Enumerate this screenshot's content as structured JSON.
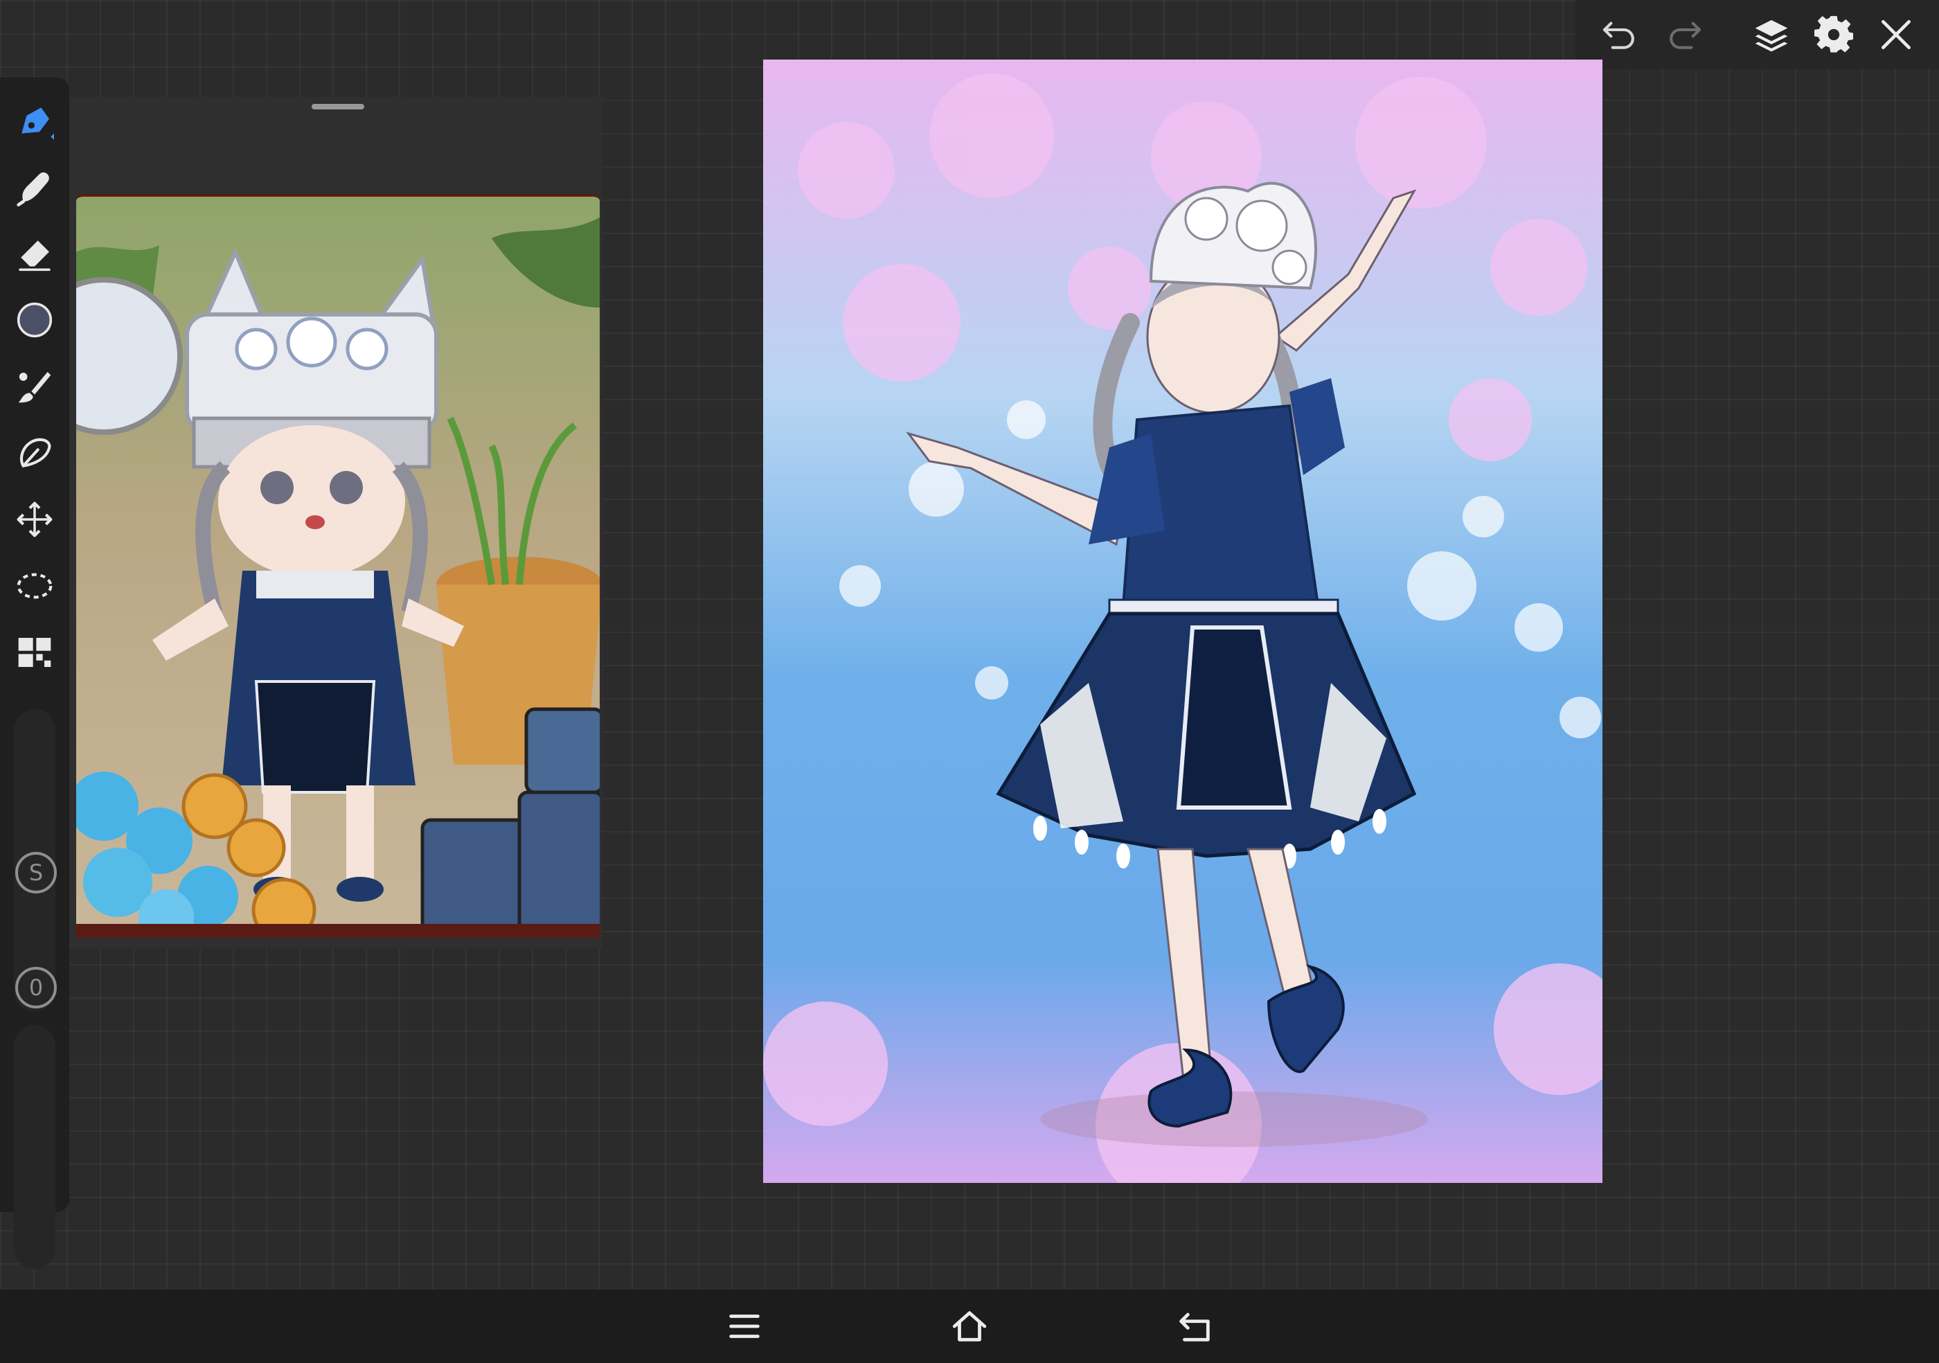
{
  "colors": {
    "accent": "#3d8ff5",
    "icon": "#e8e8e8",
    "icon_dim": "#8a8a8a",
    "rail": "#1f1f1f",
    "panel": "#2f2f2f"
  },
  "toolbar": {
    "icons": [
      "undo-icon",
      "redo-icon",
      "layers-icon",
      "settings-icon",
      "close-icon"
    ]
  },
  "tools": [
    "pen-icon",
    "smudge-icon",
    "eraser-icon",
    "color-icon",
    "brush-icon",
    "lasso-fill-icon",
    "transform-icon",
    "selection-icon",
    "gallery-icon"
  ],
  "sliders": {
    "size_label": "S",
    "opacity_label": "0"
  },
  "reference": {
    "image": "reference-photo"
  },
  "canvas": {
    "image": "artwork"
  },
  "nav": {
    "icons": [
      "menu-icon",
      "home-icon",
      "back-icon"
    ]
  }
}
